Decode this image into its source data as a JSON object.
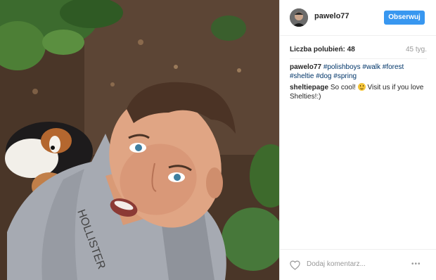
{
  "post": {
    "photo_alt": "Selfie photo with dog in forest",
    "username": "pawelo77",
    "follow_label": "Obserwuj",
    "likes_label": "Liczba polubień: 48",
    "time_ago": "45 tyg.",
    "caption": {
      "author": "pawelo77",
      "hashtags": [
        "#polishboys",
        "#walk",
        "#forest",
        "#sheltie",
        "#dog",
        "#spring"
      ]
    },
    "comment": {
      "author": "sheltiepage",
      "text_before": "So cool!",
      "text_after": "Visit us if you love Shelties!:)"
    },
    "comment_placeholder": "Dodaj komentarz...",
    "more_label": "•••"
  },
  "icons": {
    "avatar": "avatar",
    "like": "heart-icon",
    "more": "more-options-icon",
    "emoji": "smiley-emoji"
  },
  "colors": {
    "follow_button": "#3897f0",
    "hashtag": "#003569",
    "muted": "#999999"
  }
}
